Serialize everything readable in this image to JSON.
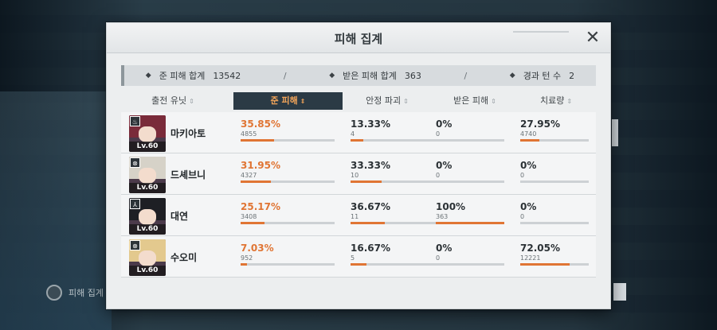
{
  "dialog": {
    "title": "피해 집계",
    "close_icon": "close-icon"
  },
  "summary": {
    "dealt_label": "준 피해 합계",
    "dealt_value": "13542",
    "received_label": "받은 피해 합계",
    "received_value": "363",
    "turns_label": "경과 턴 수",
    "turns_value": "2",
    "separator": "/"
  },
  "columns": [
    {
      "label": "출전 유닛",
      "sort": "⇕",
      "active": false
    },
    {
      "label": "준 피해",
      "sort": "⇕",
      "active": true
    },
    {
      "label": "안정 파괴",
      "sort": "⇕",
      "active": false
    },
    {
      "label": "받은 피해",
      "sort": "⇕",
      "active": false
    },
    {
      "label": "치료량",
      "sort": "⇕",
      "active": false
    }
  ],
  "units": [
    {
      "name": "마키아토",
      "level": "Lv.60",
      "hair": "#7a2b3a",
      "dealt": {
        "pct": "35.85%",
        "num": "4855",
        "ratio": 0.3585
      },
      "break": {
        "pct": "13.33%",
        "num": "4",
        "ratio": 0.1333
      },
      "received": {
        "pct": "0%",
        "num": "0",
        "ratio": 0
      },
      "heal": {
        "pct": "27.95%",
        "num": "4740",
        "ratio": 0.2795
      }
    },
    {
      "name": "드셰브니",
      "level": "Lv.60",
      "hair": "#d6d2c8",
      "dealt": {
        "pct": "31.95%",
        "num": "4327",
        "ratio": 0.3195
      },
      "break": {
        "pct": "33.33%",
        "num": "10",
        "ratio": 0.3333
      },
      "received": {
        "pct": "0%",
        "num": "0",
        "ratio": 0
      },
      "heal": {
        "pct": "0%",
        "num": "0",
        "ratio": 0
      }
    },
    {
      "name": "대연",
      "level": "Lv.60",
      "hair": "#1e1f24",
      "dealt": {
        "pct": "25.17%",
        "num": "3408",
        "ratio": 0.2517
      },
      "break": {
        "pct": "36.67%",
        "num": "11",
        "ratio": 0.3667
      },
      "received": {
        "pct": "100%",
        "num": "363",
        "ratio": 1.0
      },
      "heal": {
        "pct": "0%",
        "num": "0",
        "ratio": 0
      }
    },
    {
      "name": "수오미",
      "level": "Lv.60",
      "hair": "#e3c98e",
      "dealt": {
        "pct": "7.03%",
        "num": "952",
        "ratio": 0.0703
      },
      "break": {
        "pct": "16.67%",
        "num": "5",
        "ratio": 0.1667
      },
      "received": {
        "pct": "0%",
        "num": "0",
        "ratio": 0
      },
      "heal": {
        "pct": "72.05%",
        "num": "12221",
        "ratio": 0.7205
      }
    }
  ],
  "background": {
    "bottom_left_label": "피해 집계"
  },
  "colors": {
    "accent": "#e07534",
    "active_tab": "#2b3a45",
    "active_tab_text": "#f3a55a"
  }
}
